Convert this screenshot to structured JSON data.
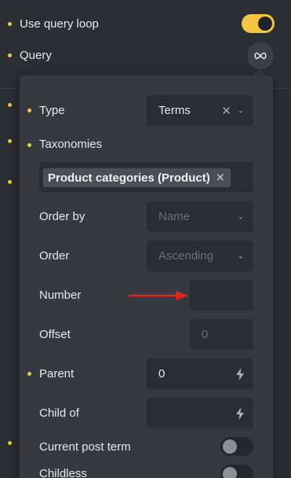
{
  "outer": {
    "use_query_loop": "Use query loop",
    "query": "Query",
    "query_icon": "infinity-icon",
    "use_query_loop_on": true
  },
  "panel": {
    "type": {
      "label": "Type",
      "value": "Terms"
    },
    "taxonomies": {
      "label": "Taxonomies",
      "tag": "Product categories (Product)"
    },
    "order_by": {
      "label": "Order by",
      "placeholder": "Name"
    },
    "order": {
      "label": "Order",
      "placeholder": "Ascending"
    },
    "number": {
      "label": "Number",
      "value": ""
    },
    "offset": {
      "label": "Offset",
      "placeholder": "0"
    },
    "parent": {
      "label": "Parent",
      "value": "0"
    },
    "child_of": {
      "label": "Child of",
      "value": ""
    },
    "current_post_term": {
      "label": "Current post term",
      "on": false
    },
    "childless": {
      "label": "Childless",
      "on": false
    }
  },
  "colors": {
    "accent": "#f4c542",
    "arrow": "#e02424"
  }
}
